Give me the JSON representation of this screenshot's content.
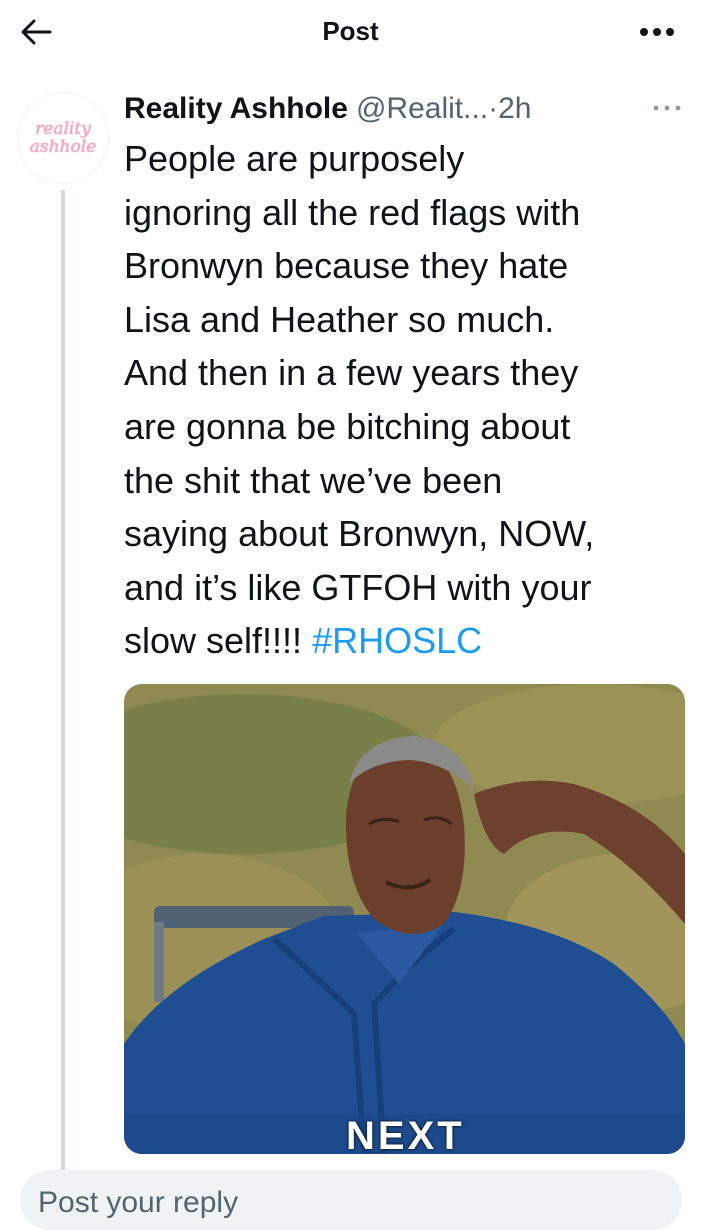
{
  "header": {
    "title": "Post",
    "back_icon": "arrow-left-icon",
    "more_icon": "more-horizontal-icon"
  },
  "post": {
    "avatar_text_line1": "reality",
    "avatar_text_line2": "ashhole",
    "display_name": "Reality Ashhole",
    "handle": "@Realit...",
    "separator": "·",
    "time": "2h",
    "text": "People are purposely\nignoring all the red flags with\nBronwyn because they hate\nLisa and Heather so much.\nAnd then in a few years they\nare gonna be bitching about\nthe shit that we’ve been\nsaying about Bronwyn, NOW,\nand it’s like GTFOH with your\nslow self!!!! ",
    "hashtag": "#RHOSLC",
    "media_caption": "NEXT",
    "hashtag_color": "#1d9bf0"
  },
  "reply": {
    "placeholder": "Post your reply"
  }
}
